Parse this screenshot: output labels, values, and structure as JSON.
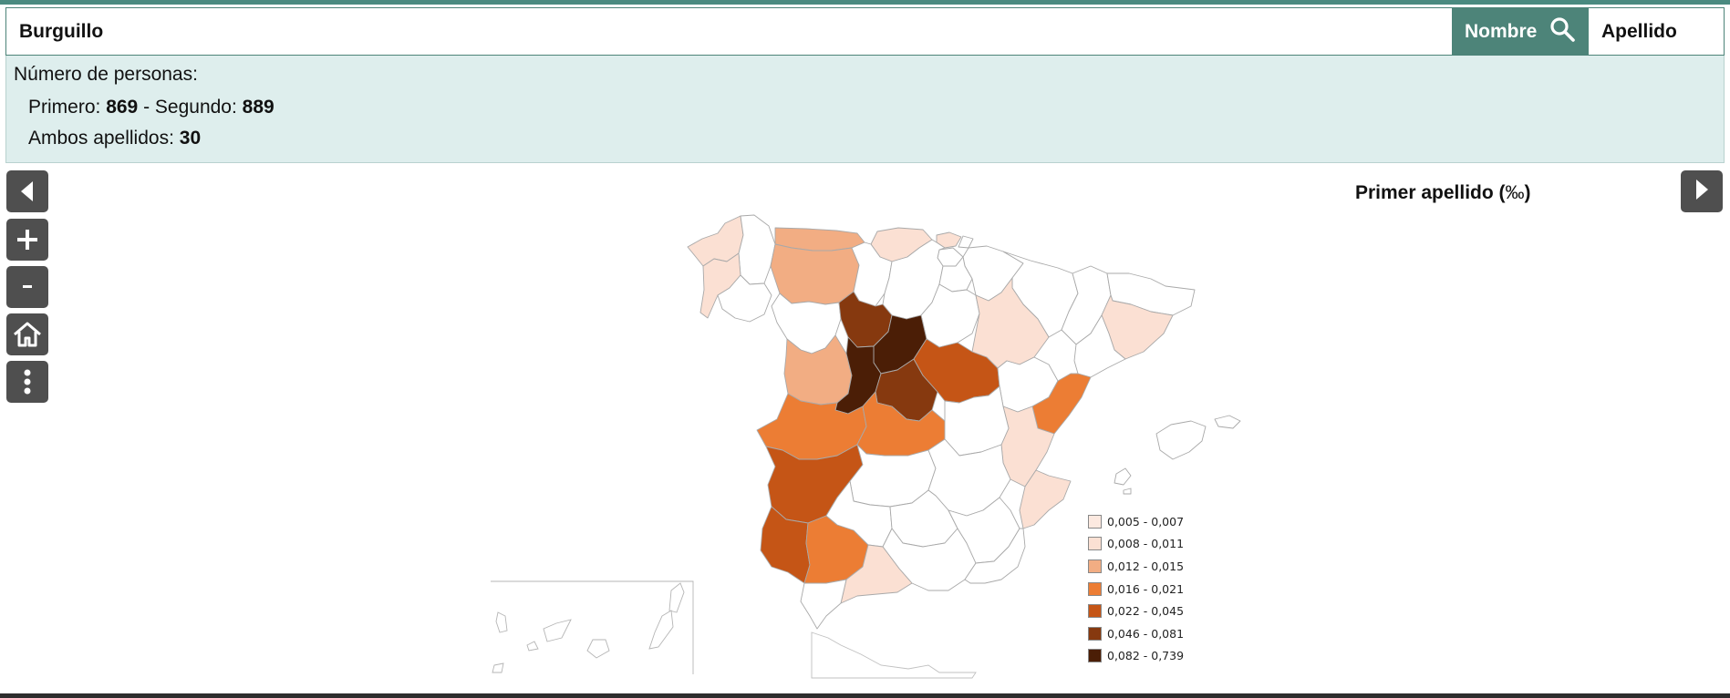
{
  "search": {
    "value": "Burguillo",
    "nombre_label": "Nombre",
    "apellido_label": "Apellido"
  },
  "info": {
    "heading": "Número de personas:",
    "primero_label": "Primero: ",
    "primero_value": "869",
    "sep": " - Segundo: ",
    "segundo_value": "889",
    "ambos_label": "Ambos apellidos: ",
    "ambos_value": "30"
  },
  "map": {
    "title": "Primer apellido (",
    "title_unit": "‰",
    "title_end": ")",
    "legend": [
      {
        "label": "0,005 - 0,007",
        "color": "#fce9e0"
      },
      {
        "label": "0,008 - 0,011",
        "color": "#fbe0d3"
      },
      {
        "label": "0,012 - 0,015",
        "color": "#f2ad83"
      },
      {
        "label": "0,016 - 0,021",
        "color": "#ec7d34"
      },
      {
        "label": "0,022 - 0,045",
        "color": "#c55516"
      },
      {
        "label": "0,046 - 0,081",
        "color": "#86390f"
      },
      {
        "label": "0,082 - 0,739",
        "color": "#4b1e06"
      }
    ]
  },
  "icons": {
    "prev": "chevron-left-icon",
    "zoom_in": "plus-icon",
    "zoom_out": "minus-icon",
    "home": "home-icon",
    "more": "more-vertical-icon",
    "next": "chevron-right-icon",
    "search": "search-icon"
  }
}
